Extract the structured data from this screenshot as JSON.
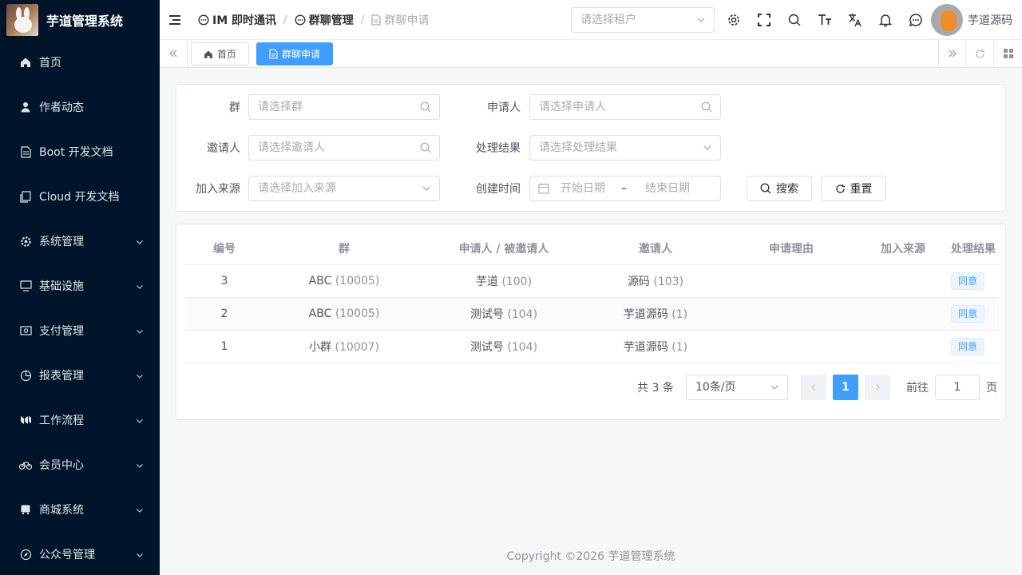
{
  "app": {
    "title": "芋道管理系统"
  },
  "sidebar": {
    "items": [
      {
        "label": "首页",
        "icon": "home-icon"
      },
      {
        "label": "作者动态",
        "icon": "user-icon"
      },
      {
        "label": "Boot 开发文档",
        "icon": "document-icon"
      },
      {
        "label": "Cloud 开发文档",
        "icon": "documents-icon"
      },
      {
        "label": "系统管理",
        "icon": "gear-icon"
      },
      {
        "label": "基础设施",
        "icon": "monitor-icon"
      },
      {
        "label": "支付管理",
        "icon": "payment-icon"
      },
      {
        "label": "报表管理",
        "icon": "pie-chart-icon"
      },
      {
        "label": "工作流程",
        "icon": "workflow-icon"
      },
      {
        "label": "会员中心",
        "icon": "bicycle-icon"
      },
      {
        "label": "商城系统",
        "icon": "shop-icon"
      },
      {
        "label": "公众号管理",
        "icon": "compass-icon"
      }
    ]
  },
  "header": {
    "breadcrumb": [
      "IM 即时通讯",
      "群聊管理",
      "群聊申请"
    ],
    "tenant_placeholder": "请选择租户",
    "username": "芋道源码"
  },
  "tags": {
    "home": "首页",
    "current": "群聊申请"
  },
  "search": {
    "group_label": "群",
    "group_placeholder": "请选择群",
    "applicant_label": "申请人",
    "applicant_placeholder": "请选择申请人",
    "inviter_label": "邀请人",
    "inviter_placeholder": "请选择邀请人",
    "result_label": "处理结果",
    "result_placeholder": "请选择处理结果",
    "source_label": "加入来源",
    "source_placeholder": "请选择加入来源",
    "time_label": "创建时间",
    "start_placeholder": "开始日期",
    "range_sep": "–",
    "end_placeholder": "结束日期",
    "search_button": "搜索",
    "reset_button": "重置"
  },
  "table": {
    "headers": [
      "编号",
      "群",
      "申请人 / 被邀请人",
      "邀请人",
      "申请理由",
      "加入来源",
      "处理结果"
    ],
    "rows": [
      {
        "id": "3",
        "group": "ABC",
        "group_id": "(10005)",
        "applicant": "芋道",
        "applicant_id": "(100)",
        "inviter": "源码",
        "inviter_id": "(103)",
        "reason": "",
        "source": "",
        "result": "同意"
      },
      {
        "id": "2",
        "group": "ABC",
        "group_id": "(10005)",
        "applicant": "测试号",
        "applicant_id": "(104)",
        "inviter": "芋道源码",
        "inviter_id": "(1)",
        "reason": "",
        "source": "",
        "result": "同意"
      },
      {
        "id": "1",
        "group": "小群",
        "group_id": "(10007)",
        "applicant": "测试号",
        "applicant_id": "(104)",
        "inviter": "芋道源码",
        "inviter_id": "(1)",
        "reason": "",
        "source": "",
        "result": "同意"
      }
    ]
  },
  "pagination": {
    "total": "共 3 条",
    "page_size": "10条/页",
    "current_page": "1",
    "goto_label": "前往",
    "goto_value": "1",
    "page_suffix": "页"
  },
  "footer": {
    "text": "Copyright ©2026 芋道管理系统"
  },
  "colors": {
    "sidebar_bg": "#001529",
    "primary": "#409eff"
  }
}
